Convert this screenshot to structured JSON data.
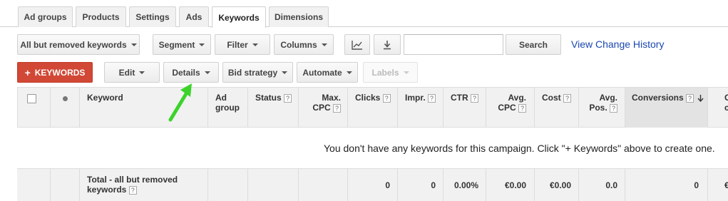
{
  "tabs": [
    {
      "label": "Ad groups"
    },
    {
      "label": "Products"
    },
    {
      "label": "Settings"
    },
    {
      "label": "Ads"
    },
    {
      "label": "Keywords"
    },
    {
      "label": "Dimensions"
    }
  ],
  "toolbar1": {
    "filter_view": "All but removed keywords",
    "segment": "Segment",
    "filter": "Filter",
    "columns": "Columns",
    "search_value": "",
    "search_button": "Search",
    "change_history": "View Change History"
  },
  "toolbar2": {
    "add_keywords": "KEYWORDS",
    "add_keywords_plus": "+",
    "edit": "Edit",
    "details": "Details",
    "bid_strategy": "Bid strategy",
    "automate": "Automate",
    "labels": "Labels"
  },
  "table": {
    "headers": {
      "keyword": "Keyword",
      "ad_group_1": "Ad",
      "ad_group_2": "group",
      "status": "Status",
      "max_cpc_1": "Max.",
      "max_cpc_2": "CPC",
      "clicks": "Clicks",
      "impr": "Impr.",
      "ctr": "CTR",
      "avg_cpc_1": "Avg.",
      "avg_cpc_2": "CPC",
      "cost": "Cost",
      "avg_pos_1": "Avg.",
      "avg_pos_2": "Pos.",
      "conversions": "Conversions",
      "cut_1": "C",
      "cut_2": "cor"
    },
    "help_mark": "?",
    "empty_message": "You don't have any keywords for this campaign. Click \"+ Keywords\" above to create one.",
    "total": {
      "label_1": "Total - all but removed",
      "label_2": "keywords",
      "clicks": "0",
      "impr": "0",
      "ctr": "0.00%",
      "avg_cpc": "€0.00",
      "cost": "€0.00",
      "avg_pos": "0.0",
      "conversions": "0",
      "cut": "€"
    }
  },
  "colors": {
    "accent_red": "#d14836",
    "link_blue": "#1a47b0",
    "arrow_green": "#3bd32a"
  }
}
